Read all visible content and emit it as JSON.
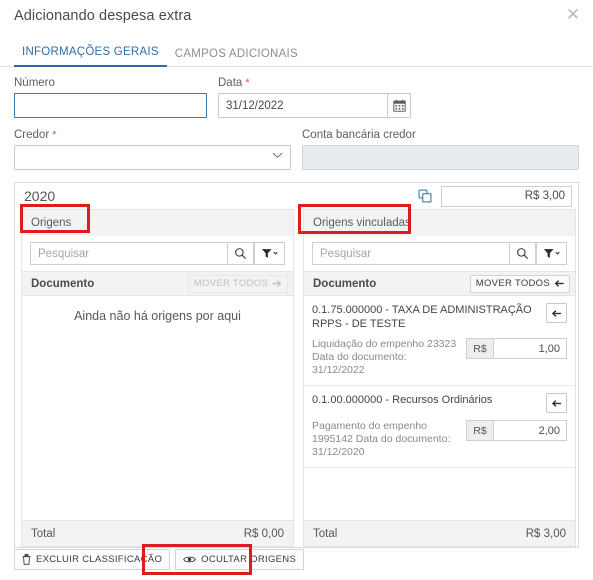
{
  "dialog": {
    "title": "Adicionando despesa extra",
    "close_icon": "close-icon"
  },
  "tabs": [
    {
      "label": "INFORMAÇÕES GERAIS",
      "active": true
    },
    {
      "label": "CAMPOS ADICIONAIS",
      "active": false
    }
  ],
  "form": {
    "numero": {
      "label": "Número",
      "value": "",
      "placeholder": "",
      "required": false
    },
    "data": {
      "label": "Data",
      "value": "31/12/2022",
      "required": true,
      "icon": "calendar-icon"
    },
    "credor": {
      "label": "Credor",
      "value": "",
      "required": true,
      "icon": "chevron-down-icon"
    },
    "conta_bancaria": {
      "label": "Conta bancária credor",
      "value": "",
      "required": false,
      "readonly": true
    }
  },
  "classification": {
    "year": "2020",
    "copy_icon": "copy-icon",
    "amount": "R$ 3,00",
    "left_panel": {
      "title": "Origens",
      "search_placeholder": "Pesquisar",
      "search_value": "",
      "search_icon": "search-icon",
      "filter_icon": "filter-icon",
      "column_header": "Documento",
      "move_all_label": "MOVER TODOS",
      "move_all_icon": "arrow-right-icon",
      "move_all_disabled": true,
      "empty_message": "Ainda não há origens por aqui",
      "items": [],
      "total_label": "Total",
      "total_value": "R$ 0,00"
    },
    "right_panel": {
      "title": "Origens vinculadas",
      "search_placeholder": "Pesquisar",
      "search_value": "",
      "search_icon": "search-icon",
      "filter_icon": "filter-icon",
      "column_header": "Documento",
      "move_all_label": "MOVER TODOS",
      "move_all_icon": "arrow-left-icon",
      "move_all_disabled": false,
      "items": [
        {
          "title": "0.1.75.000000 - TAXA DE ADMINISTRAÇÃO RPPS - DE TESTE",
          "description": "Liquidação do empenho 23323 Data do documento: 31/12/2022",
          "currency_prefix": "R$",
          "value": "1,00",
          "move_icon": "arrow-left-icon"
        },
        {
          "title": "0.1.00.000000 - Recursos Ordinários",
          "description": "Pagamento do empenho 1995142 Data do documento: 31/12/2020",
          "currency_prefix": "R$",
          "value": "2,00",
          "move_icon": "arrow-left-icon"
        }
      ],
      "total_label": "Total",
      "total_value": "R$ 3,00"
    }
  },
  "toolbar": {
    "delete_label": "EXCLUIR CLASSIFICAÇÃO",
    "delete_icon": "trash-icon",
    "hide_label": "OCULTAR ORIGENS",
    "hide_icon": "eye-icon"
  },
  "colors": {
    "accent": "#2e6da4",
    "required": "#d9534f",
    "annotation": "#e01b1b",
    "panel_header_bg": "#f3f3f3"
  }
}
